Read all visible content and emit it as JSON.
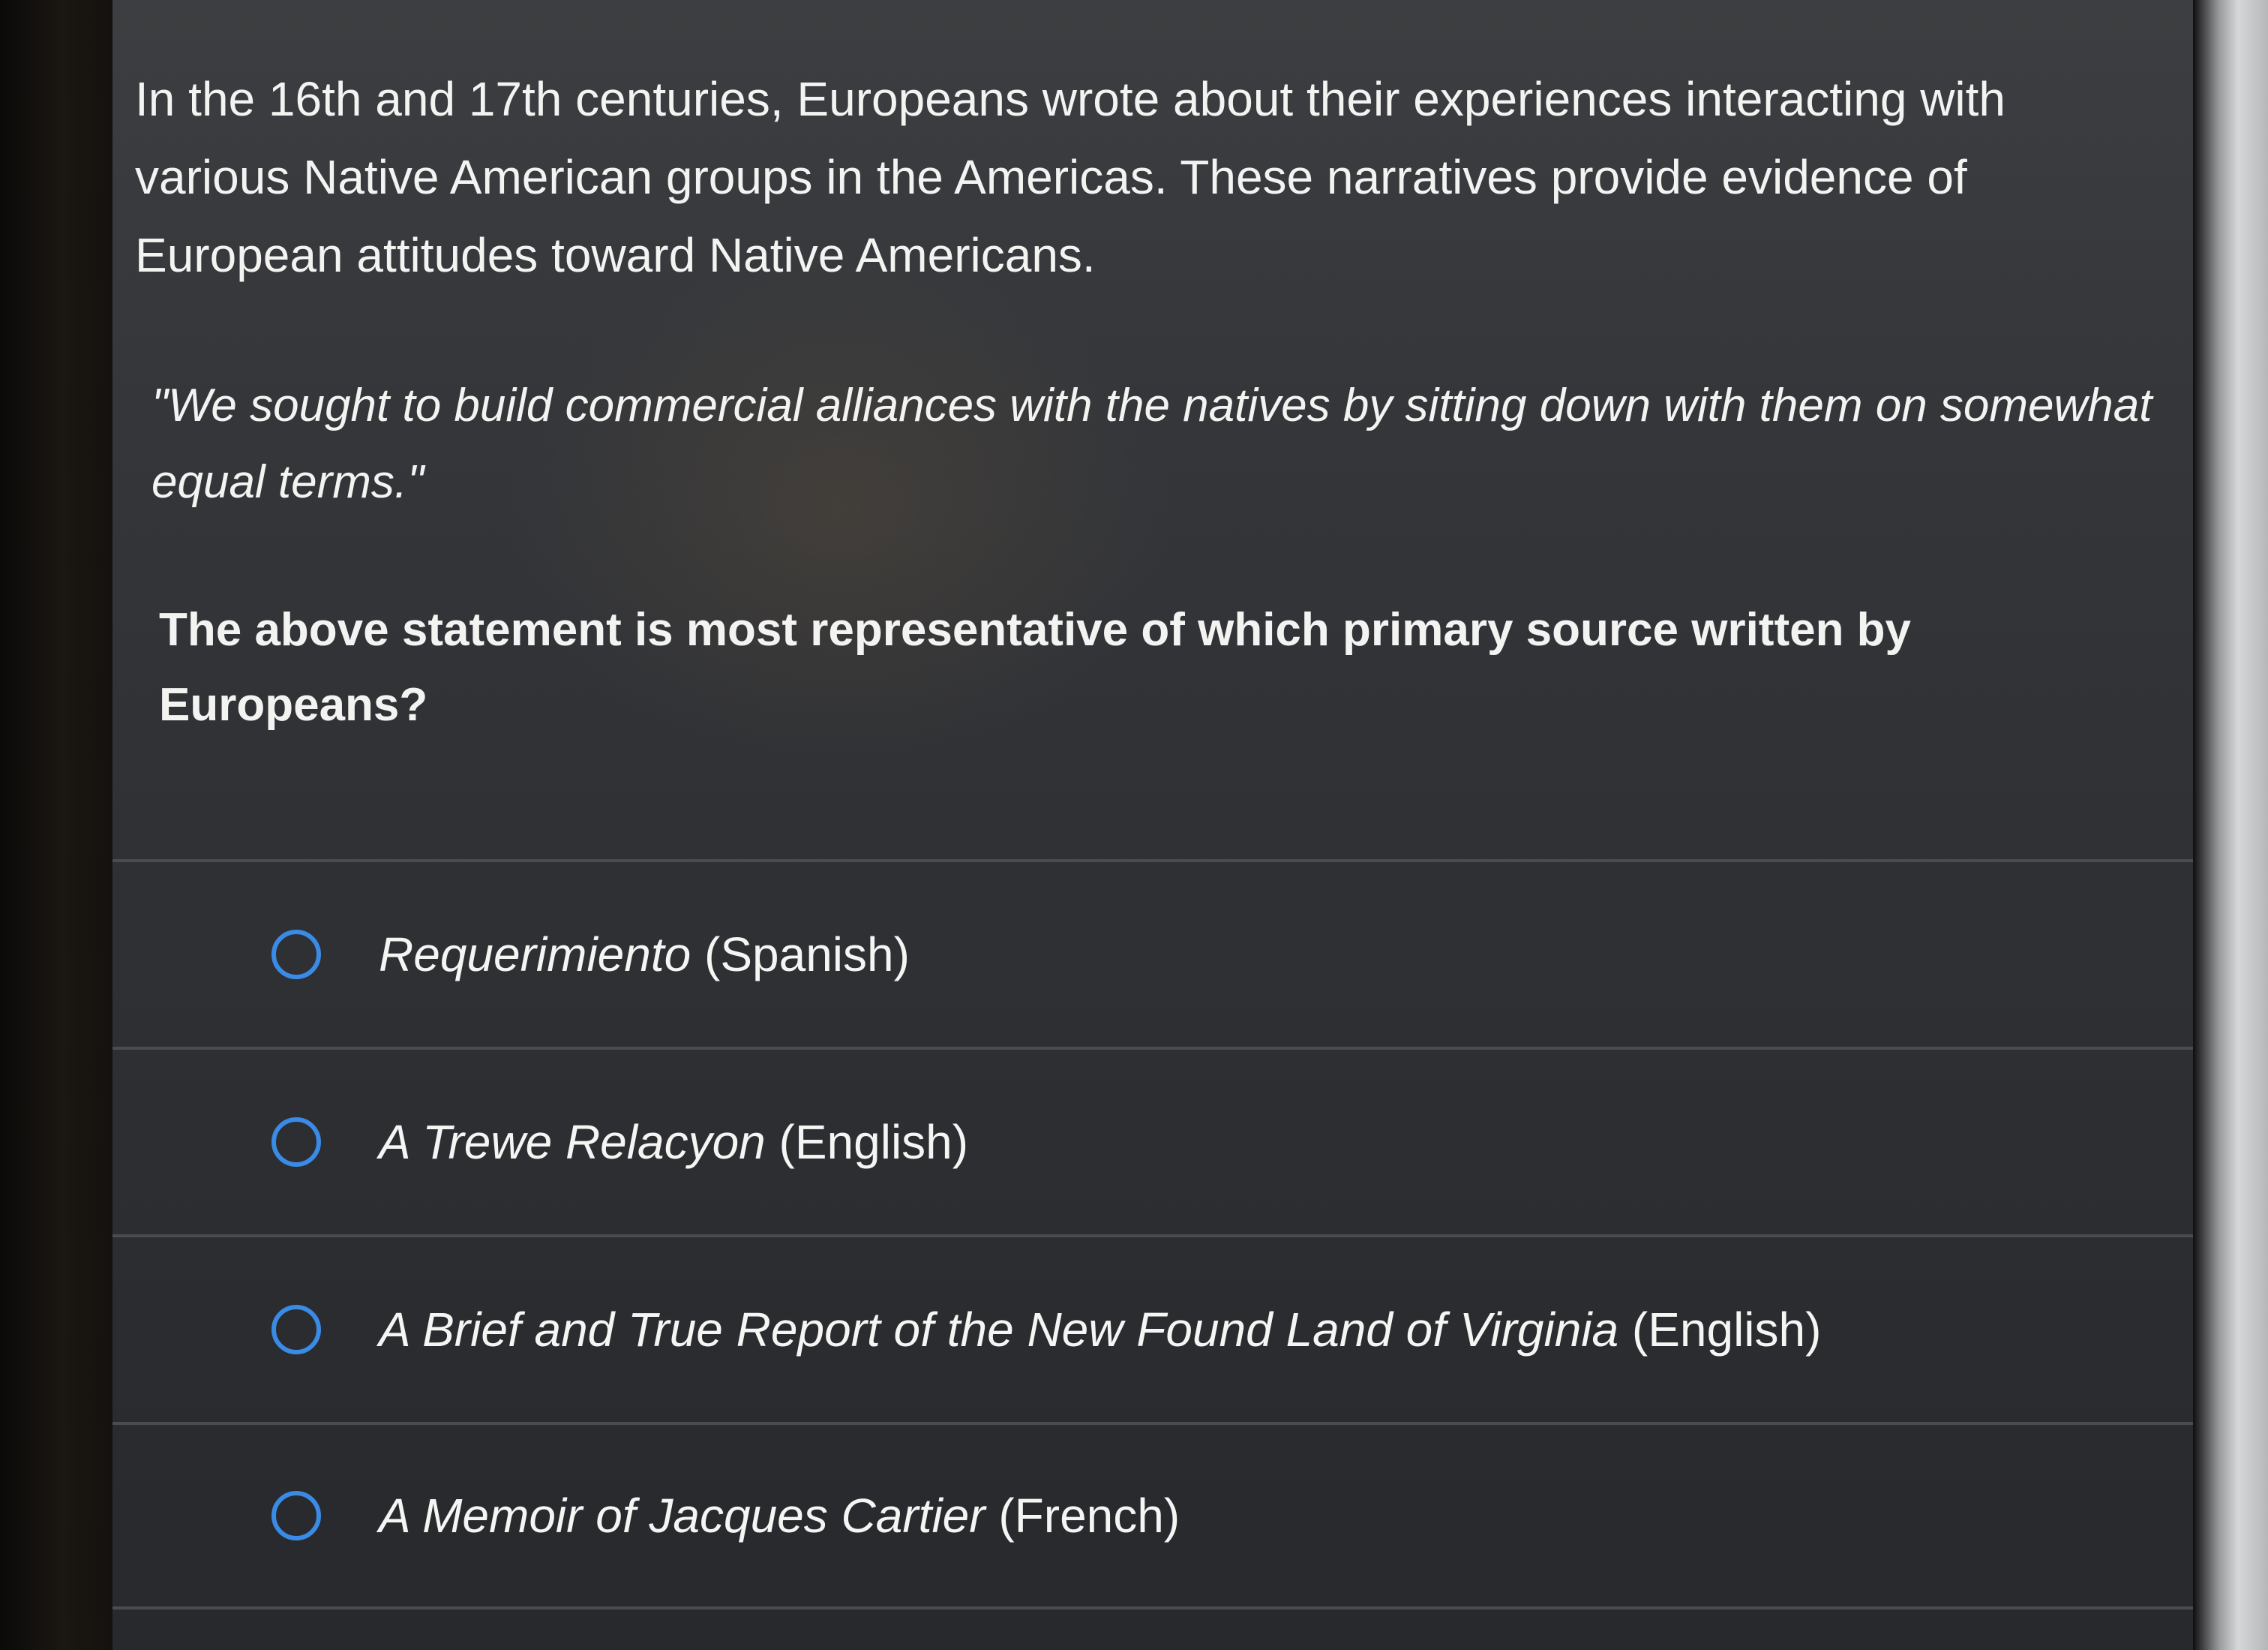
{
  "question": {
    "intro": "In the 16th and 17th centuries, Europeans wrote about their experiences interacting with various Native American groups in the Americas. These narratives provide evidence of European attitudes toward Native Americans.",
    "quote": "\"We sought to build commercial alliances with the natives by sitting down with them on somewhat equal terms.\"",
    "prompt": "The above statement is most representative of which primary source written by Europeans?"
  },
  "choices": [
    {
      "title": "Requerimiento",
      "suffix": " (Spanish)"
    },
    {
      "title": "A Trewe Relacyon",
      "suffix": " (English)"
    },
    {
      "title": "A Brief and True Report of the New Found Land of Virginia",
      "suffix": " (English)"
    },
    {
      "title": "A Memoir of Jacques Cartier",
      "suffix": " (French)"
    }
  ],
  "colors": {
    "background": "#2f3135",
    "text": "#f3f3f1",
    "radio_accent": "#3a8be6",
    "divider": "#4a4c50"
  },
  "icons": {
    "radio": "radio-unselected-icon"
  }
}
